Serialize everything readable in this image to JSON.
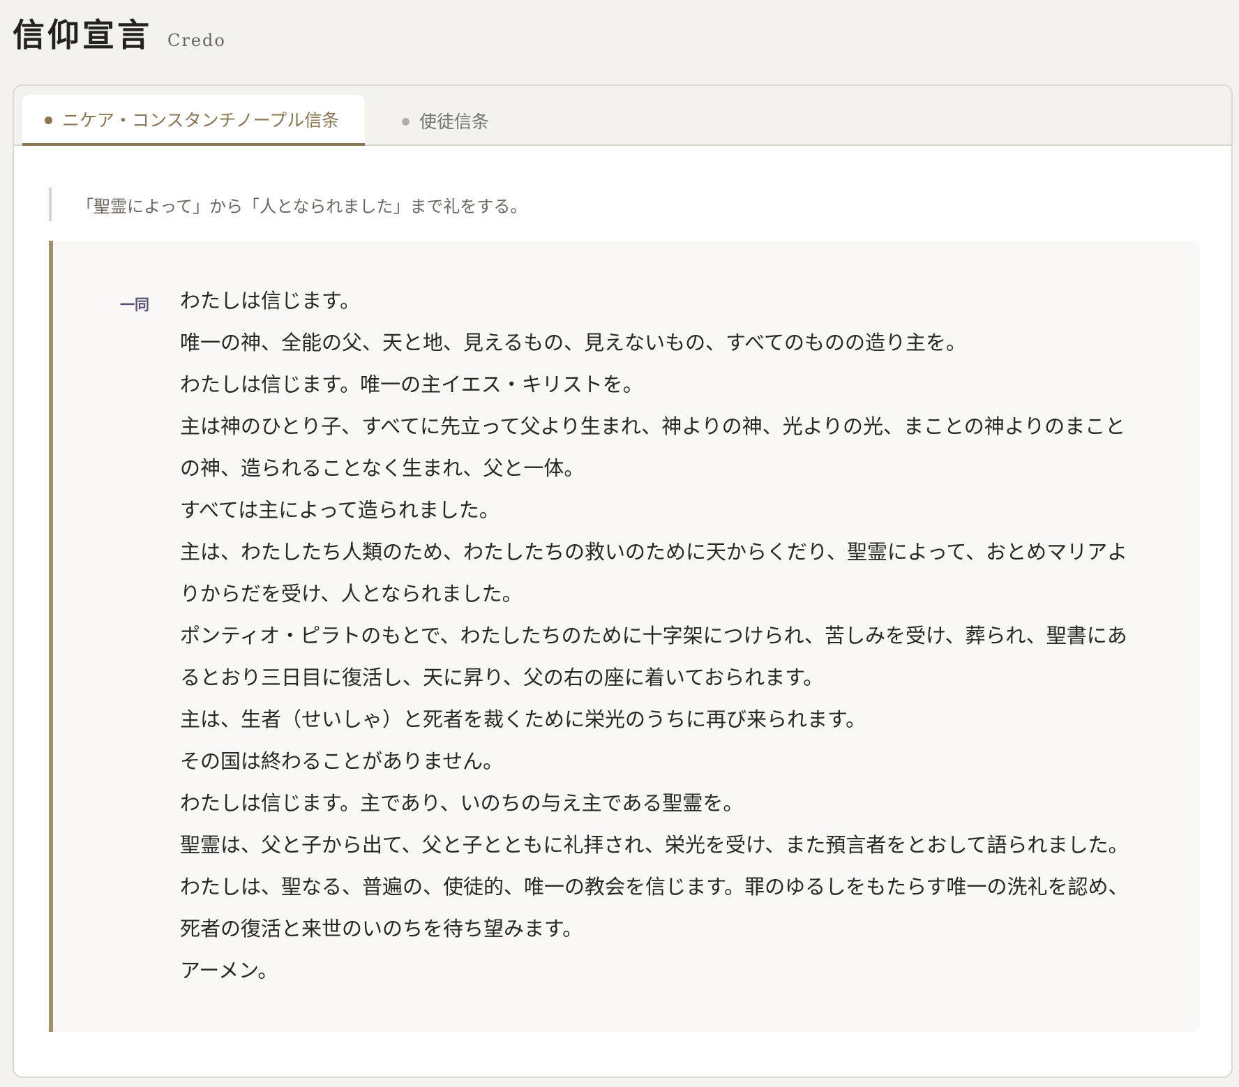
{
  "header": {
    "title": "信仰宣言",
    "subtitle": "Credo"
  },
  "tabs": [
    {
      "label": "ニケア・コンスタンチノープル信条",
      "active": true
    },
    {
      "label": "使徒信条",
      "active": false
    }
  ],
  "rubric": "「聖霊によって」から「人となられました」まで礼をする。",
  "prayer": {
    "speaker": "一同",
    "lines": [
      "わたしは信じます。",
      "唯一の神、全能の父、天と地、見えるもの、見えないもの、すべてのものの造り主を。",
      "わたしは信じます。唯一の主イエス・キリストを。",
      "主は神のひとり子、すべてに先立って父より生まれ、神よりの神、光よりの光、まことの神よりのまこと",
      "の神、造られることなく生まれ、父と一体。",
      "すべては主によって造られました。",
      "主は、わたしたち人類のため、わたしたちの救いのために天からくだり、聖霊によって、おとめマリアよ",
      "りからだを受け、人となられました。",
      "ポンティオ・ピラトのもとで、わたしたちのために十字架につけられ、苦しみを受け、葬られ、聖書にあ",
      "るとおり三日目に復活し、天に昇り、父の右の座に着いておられます。",
      "主は、生者（せいしゃ）と死者を裁くために栄光のうちに再び来られます。",
      "その国は終わることがありません。",
      "わたしは信じます。主であり、いのちの与え主である聖霊を。",
      "聖霊は、父と子から出て、父と子とともに礼拝され、栄光を受け、また預言者をとおして語られました。",
      "わたしは、聖なる、普遍の、使徒的、唯一の教会を信じます。罪のゆるしをもたらす唯一の洗礼を認め、",
      "死者の復活と来世のいのちを待ち望みます。",
      "アーメン。"
    ]
  },
  "colors": {
    "accent": "#8b7753",
    "box_border": "#a49068",
    "speaker": "#5c4f73",
    "background": "#f3f2ef"
  }
}
